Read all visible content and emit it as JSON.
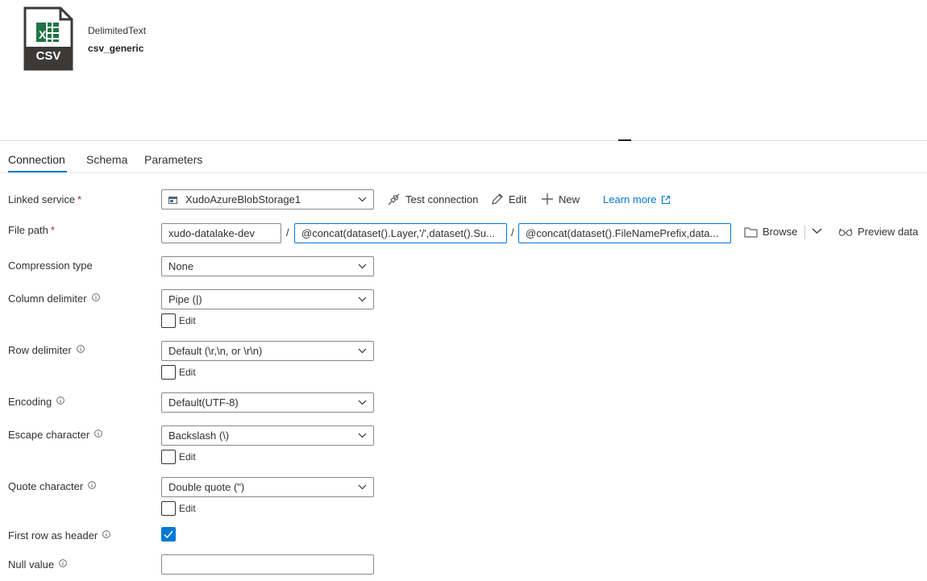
{
  "header": {
    "icon_label": "CSV",
    "type_label": "DelimitedText",
    "name": "csv_generic"
  },
  "tabs": [
    {
      "label": "Connection",
      "active": true
    },
    {
      "label": "Schema",
      "active": false
    },
    {
      "label": "Parameters",
      "active": false
    }
  ],
  "form": {
    "linked_service": {
      "label": "Linked service",
      "required": "*",
      "value": "XudoAzureBlobStorage1",
      "actions": {
        "test_connection": "Test connection",
        "edit": "Edit",
        "new": "New",
        "learn_more": "Learn more"
      }
    },
    "file_path": {
      "label": "File path",
      "required": "*",
      "container": "xudo-datalake-dev",
      "directory": "@concat(dataset().Layer,'/',dataset().Su...",
      "file": "@concat(dataset().FileNamePrefix,data...",
      "separator": "/",
      "browse": "Browse",
      "preview": "Preview data"
    },
    "compression_type": {
      "label": "Compression type",
      "value": "None"
    },
    "column_delimiter": {
      "label": "Column delimiter",
      "value": "Pipe (|)",
      "edit_label": "Edit",
      "edit_checked": false
    },
    "row_delimiter": {
      "label": "Row delimiter",
      "value": "Default (\\r,\\n, or \\r\\n)",
      "edit_label": "Edit",
      "edit_checked": false
    },
    "encoding": {
      "label": "Encoding",
      "value": "Default(UTF-8)"
    },
    "escape_character": {
      "label": "Escape character",
      "value": "Backslash (\\)",
      "edit_label": "Edit",
      "edit_checked": false
    },
    "quote_character": {
      "label": "Quote character",
      "value": "Double quote (\")",
      "edit_label": "Edit",
      "edit_checked": false
    },
    "first_row_header": {
      "label": "First row as header",
      "checked": true
    },
    "null_value": {
      "label": "Null value",
      "value": ""
    }
  },
  "colors": {
    "accent": "#0078d4",
    "required": "#a4262c",
    "csv_green": "#217346",
    "icon_dark": "#3b3a39"
  }
}
